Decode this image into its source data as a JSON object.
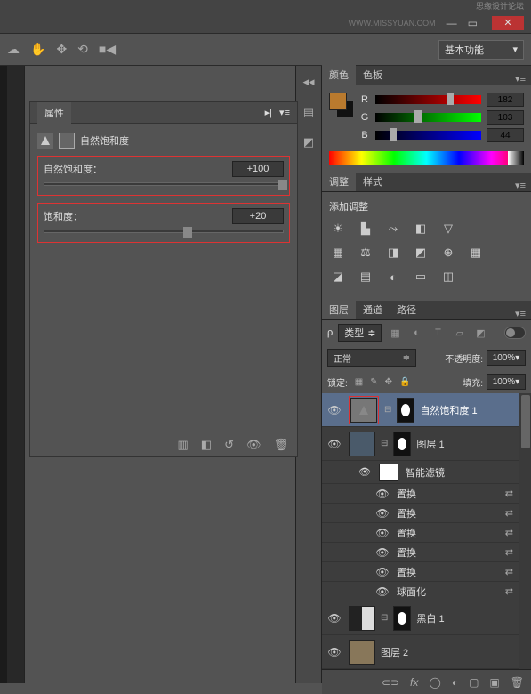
{
  "titlebar": {
    "watermark": "思缘设计论坛",
    "url": "WWW.MISSYUAN.COM"
  },
  "workspace": {
    "label": "基本功能"
  },
  "properties": {
    "tab": "属性",
    "adjustment_name": "自然饱和度",
    "sliders": {
      "vibrance": {
        "label": "自然饱和度：",
        "value": "+100",
        "pos": 100
      },
      "saturation": {
        "label": "饱和度：",
        "value": "+20",
        "pos": 60
      }
    }
  },
  "color_panel": {
    "tabs": [
      "颜色",
      "色板"
    ],
    "fg_color": "#b97a2e",
    "r": {
      "label": "R",
      "value": "182",
      "pos": 71
    },
    "g": {
      "label": "G",
      "value": "103",
      "pos": 40
    },
    "b": {
      "label": "B",
      "value": "44",
      "pos": 17
    }
  },
  "adjustments_panel": {
    "tabs": [
      "调整",
      "样式"
    ],
    "title": "添加调整"
  },
  "layers_panel": {
    "tabs": [
      "图层",
      "通道",
      "路径"
    ],
    "filter_label": "类型",
    "blend_label": "正常",
    "opacity_label": "不透明度:",
    "opacity_value": "100%",
    "lock_label": "锁定:",
    "fill_label": "填充:",
    "fill_value": "100%",
    "layers": [
      {
        "name": "自然饱和度 1",
        "type": "adj",
        "selected": true
      },
      {
        "name": "图层 1",
        "type": "img",
        "smart": true
      },
      {
        "name": "黑白 1",
        "type": "adj2"
      },
      {
        "name": "图层 2",
        "type": "img2"
      }
    ],
    "smart_filters_label": "智能滤镜",
    "filters": [
      "置换",
      "置换",
      "置换",
      "置换",
      "置换",
      "球面化"
    ]
  }
}
